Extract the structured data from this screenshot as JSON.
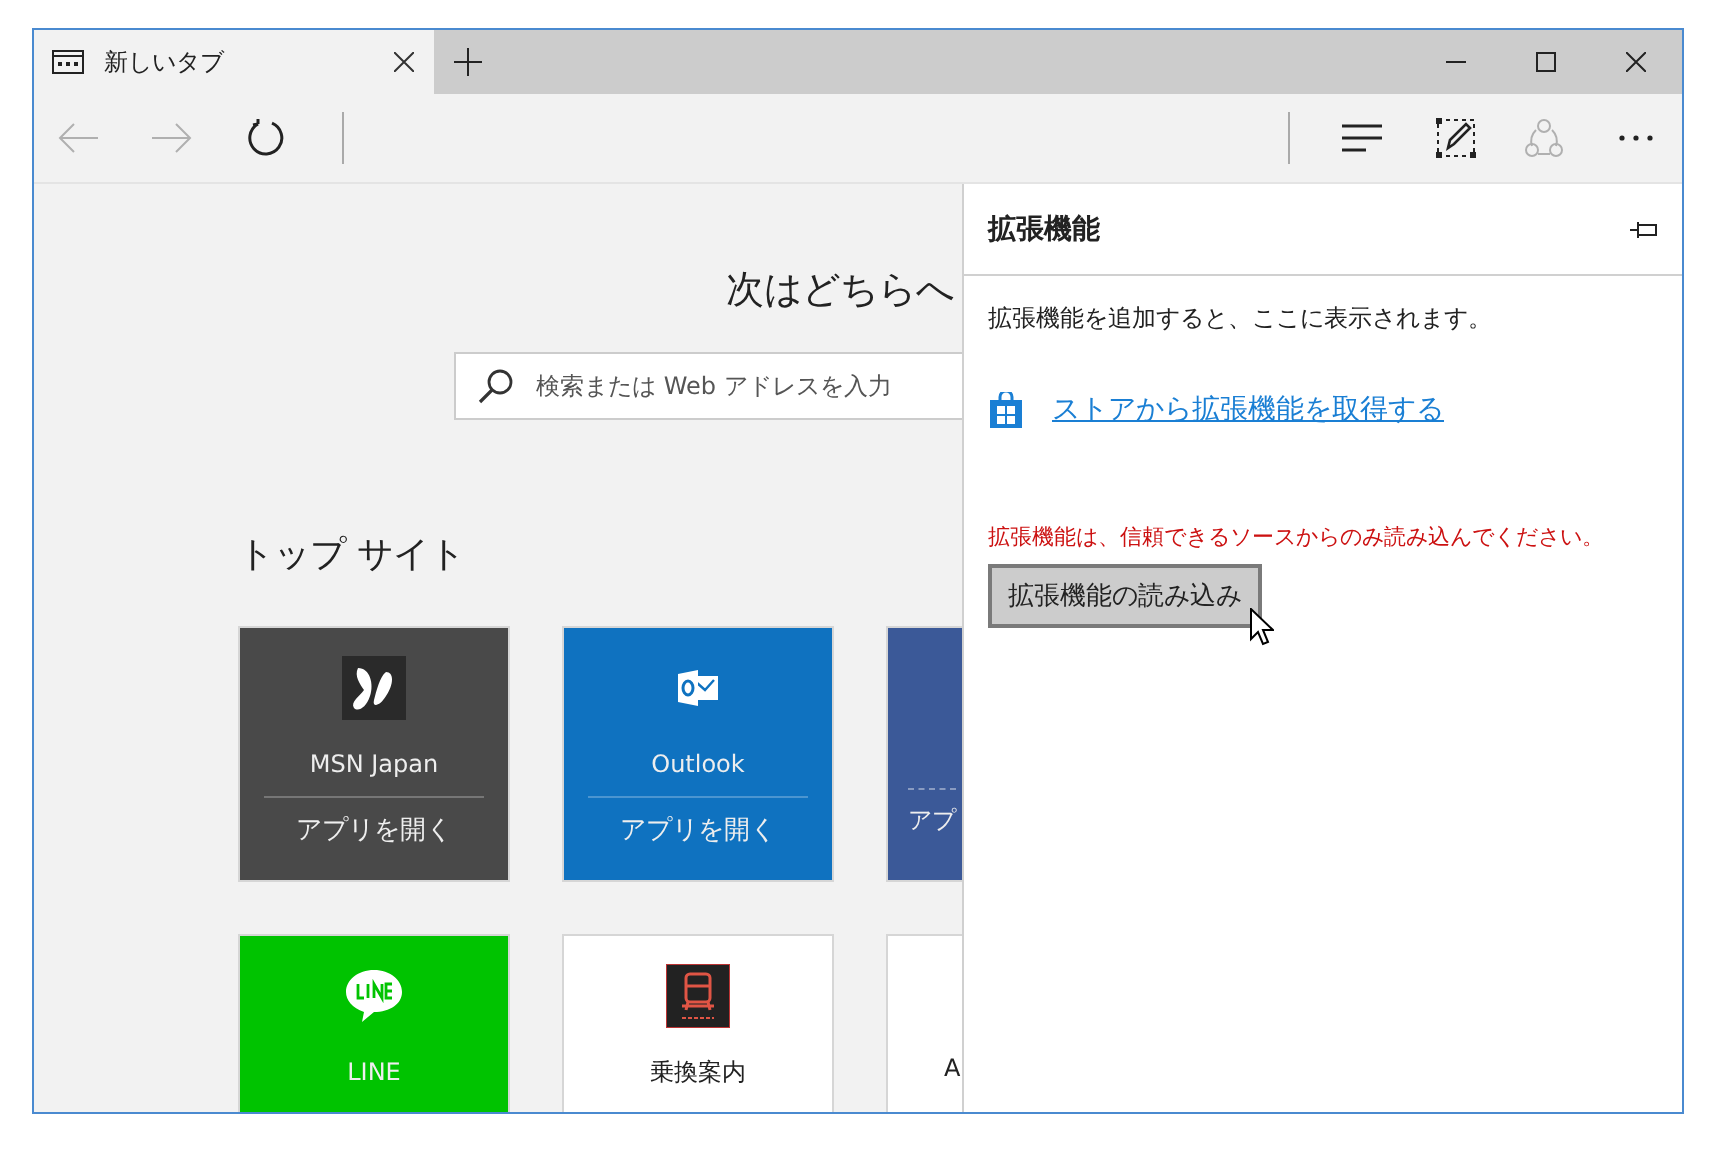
{
  "window": {
    "tab": {
      "title": "新しいタブ",
      "selected": true
    }
  },
  "toolbar": {
    "back": {
      "disabled": true
    },
    "forward": {
      "disabled": true
    },
    "refresh": {
      "disabled": false
    },
    "hub": {
      "disabled": false
    },
    "web_note": {
      "disabled": false
    },
    "share": {
      "disabled": true
    },
    "more": {
      "disabled": false
    }
  },
  "new_tab_page": {
    "heading": "次はどちらへ",
    "search": {
      "placeholder": "検索または Web アドレスを入力"
    },
    "top_sites_title": "トップ サイト",
    "tiles": [
      {
        "kind": "app",
        "name": "MSN Japan",
        "action": "アプリを開く",
        "color": "#494949"
      },
      {
        "kind": "app",
        "name": "Outlook",
        "action": "アプリを開く",
        "color": "#0f72c0"
      },
      {
        "kind": "cut",
        "action": "アプ",
        "color": "#3b5998"
      },
      {
        "kind": "site",
        "name": "LINE",
        "color": "#00c300"
      },
      {
        "kind": "site",
        "name": "乗換案内",
        "color": "#ffffff"
      },
      {
        "kind": "cut",
        "name": "A",
        "color": "#ffffff"
      }
    ]
  },
  "extensions_panel": {
    "title": "拡張機能",
    "message": "拡張機能を追加すると、ここに表示されます。",
    "store_link": "ストアから拡張機能を取得する",
    "warning": "拡張機能は、信頼できるソースからのみ読み込んでください。",
    "load_button": "拡張機能の読み込み"
  }
}
